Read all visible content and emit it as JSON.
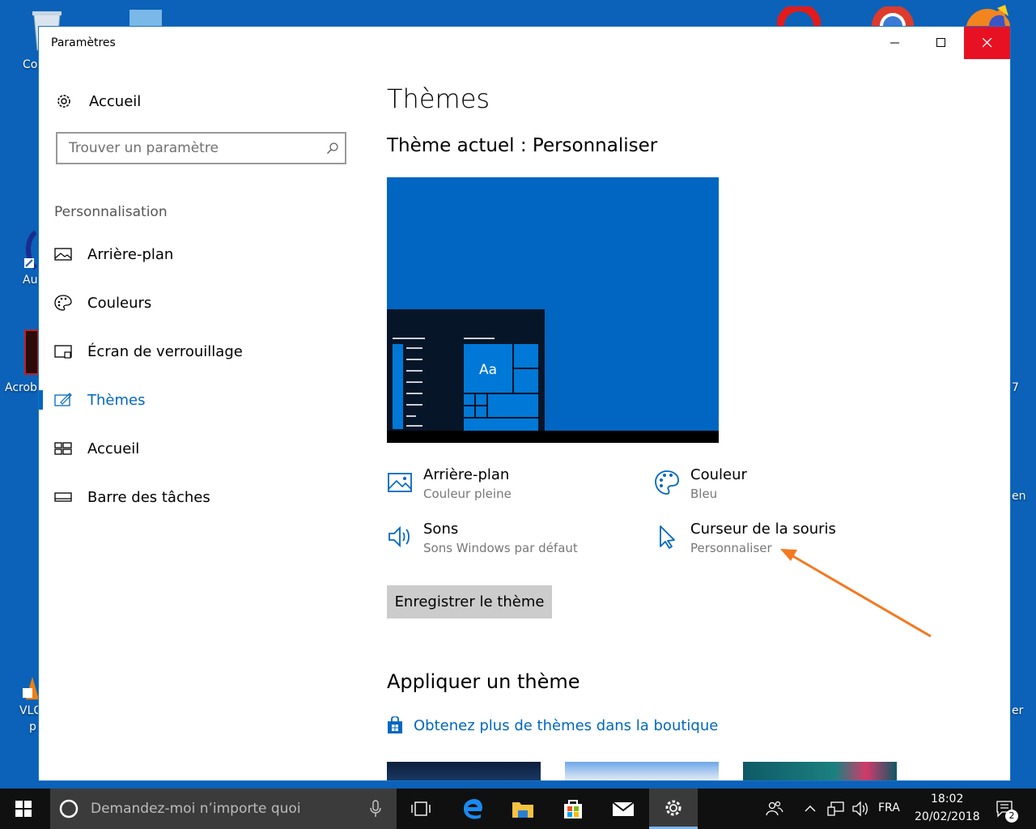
{
  "window": {
    "title": "Paramètres"
  },
  "sidebar": {
    "home_label": "Accueil",
    "search_placeholder": "Trouver un paramètre",
    "section": "Personnalisation",
    "items": [
      {
        "label": "Arrière-plan",
        "icon": "image-icon"
      },
      {
        "label": "Couleurs",
        "icon": "palette-icon"
      },
      {
        "label": "Écran de verrouillage",
        "icon": "lock-screen-icon"
      },
      {
        "label": "Thèmes",
        "icon": "themes-icon",
        "active": true
      },
      {
        "label": "Accueil",
        "icon": "start-icon"
      },
      {
        "label": "Barre des tâches",
        "icon": "taskbar-icon"
      }
    ]
  },
  "main": {
    "title": "Thèmes",
    "current_theme_heading": "Thème actuel : Personnaliser",
    "preview_sample_text": "Aa",
    "options": [
      {
        "title": "Arrière-plan",
        "subtitle": "Couleur pleine",
        "icon": "image-icon"
      },
      {
        "title": "Couleur",
        "subtitle": "Bleu",
        "icon": "palette-icon"
      },
      {
        "title": "Sons",
        "subtitle": "Sons Windows par défaut",
        "icon": "speaker-icon"
      },
      {
        "title": "Curseur de la souris",
        "subtitle": "Personnaliser",
        "icon": "cursor-icon"
      }
    ],
    "save_button": "Enregistrer le thème",
    "apply_heading": "Appliquer un thème",
    "store_link": "Obtenez plus de thèmes dans la boutique"
  },
  "taskbar": {
    "search_text": "Demandez-moi n’importe quoi",
    "language": "FRA",
    "time": "18:02",
    "date": "20/02/2018",
    "notification_count": "2"
  },
  "colors": {
    "accent": "#0067c0",
    "desktop": "#0b62b8",
    "close_button": "#e81123",
    "annotation_arrow": "#f47920"
  }
}
